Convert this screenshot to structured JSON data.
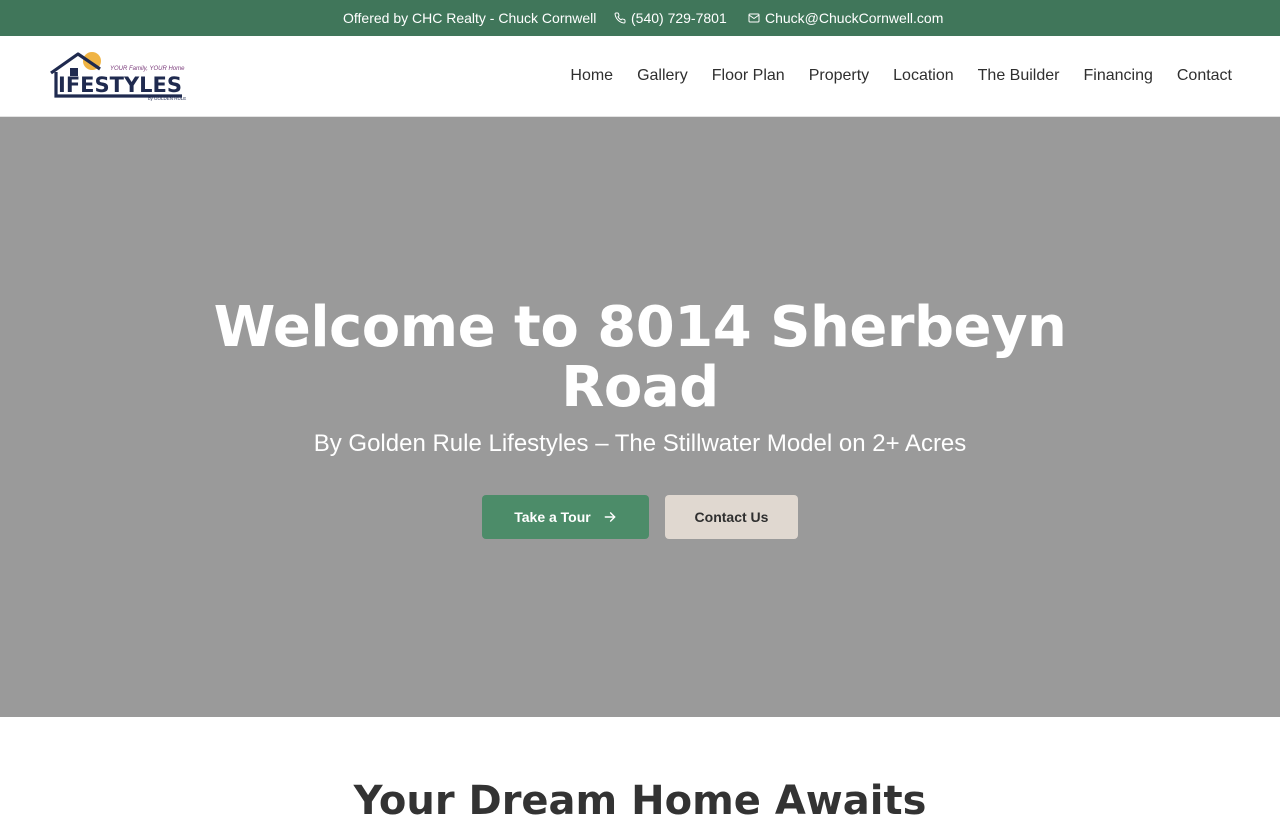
{
  "topbar": {
    "offer": "Offered by CHC Realty - Chuck Cornwell",
    "phone": "(540) 729-7801",
    "email": "Chuck@ChuckCornwell.com",
    "phone_icon": "phone-icon",
    "email_icon": "envelope-icon"
  },
  "logo": {
    "wordmark": "LIFESTYLES",
    "tagline": "YOUR Family, YOUR Home",
    "byline": "by GOLDEN RULE"
  },
  "nav": {
    "items": [
      "Home",
      "Gallery",
      "Floor Plan",
      "Property",
      "Location",
      "The Builder",
      "Financing",
      "Contact"
    ]
  },
  "hero": {
    "title": "Welcome to 8014 Sherbeyn Road",
    "subtitle": "By Golden Rule Lifestyles – The Stillwater Model on 2+ Acres",
    "primary_button": "Take a Tour",
    "primary_button_icon": "arrow-right-icon",
    "secondary_button": "Contact Us"
  },
  "section": {
    "title": "Your Dream Home Awaits"
  },
  "colors": {
    "topbar": "#40765a",
    "primary_button": "#4c8c69",
    "secondary_button": "#e0d8d0",
    "hero_background": "#9a9a9a",
    "logo_navy": "#1f2a4f",
    "logo_sun": "#f0b444"
  }
}
